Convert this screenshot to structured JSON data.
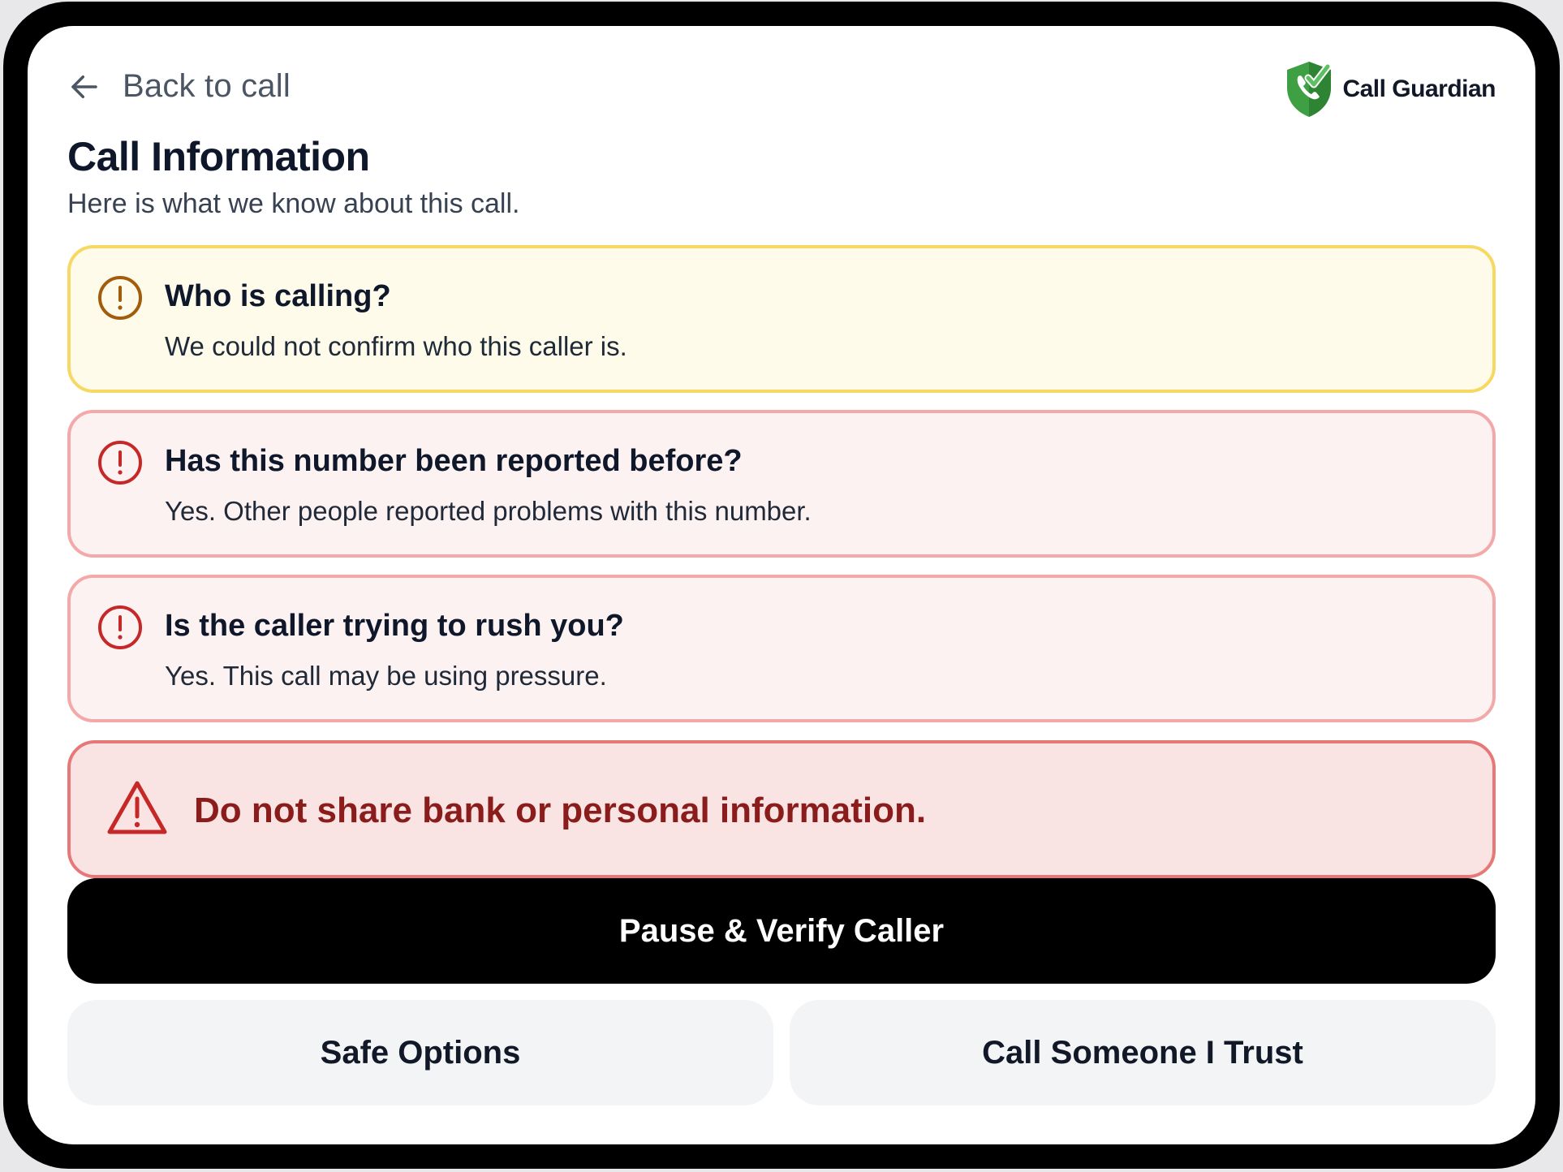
{
  "header": {
    "back_label": "Back to call",
    "back_icon": "arrow-left-icon",
    "brand_name": "Call Guardian",
    "brand_icon": "shield-phone-check-icon"
  },
  "page": {
    "title": "Call Information",
    "subtitle": "Here is what we know about this call."
  },
  "cards": [
    {
      "title": "Who is calling?",
      "description": "We could not confirm who this caller is.",
      "icon": "alert-circle-icon",
      "status": "caution",
      "color": "#a15c0c"
    },
    {
      "title": "Has this number been reported before?",
      "description": "Yes. Other people reported problems with this number.",
      "icon": "alert-circle-icon",
      "status": "danger",
      "color": "#c62828"
    },
    {
      "title": "Is the caller trying to rush you?",
      "description": "Yes. This call may be using pressure.",
      "icon": "alert-circle-icon",
      "status": "danger",
      "color": "#c62828"
    }
  ],
  "warning": {
    "text": "Do not share bank or personal information.",
    "icon": "warning-triangle-icon",
    "color": "#c62828"
  },
  "actions": {
    "primary_label": "Pause & Verify Caller",
    "safe_options_label": "Safe Options",
    "call_trusted_label": "Call Someone I Trust"
  },
  "colors": {
    "caution_bg": "#fefbea",
    "caution_border": "#f6d863",
    "danger_bg": "#fdf2f2",
    "danger_border": "#f3a9a9",
    "warning_bg": "#f9e3e3",
    "warning_border": "#e67878",
    "brand_green": "#3ea043"
  }
}
